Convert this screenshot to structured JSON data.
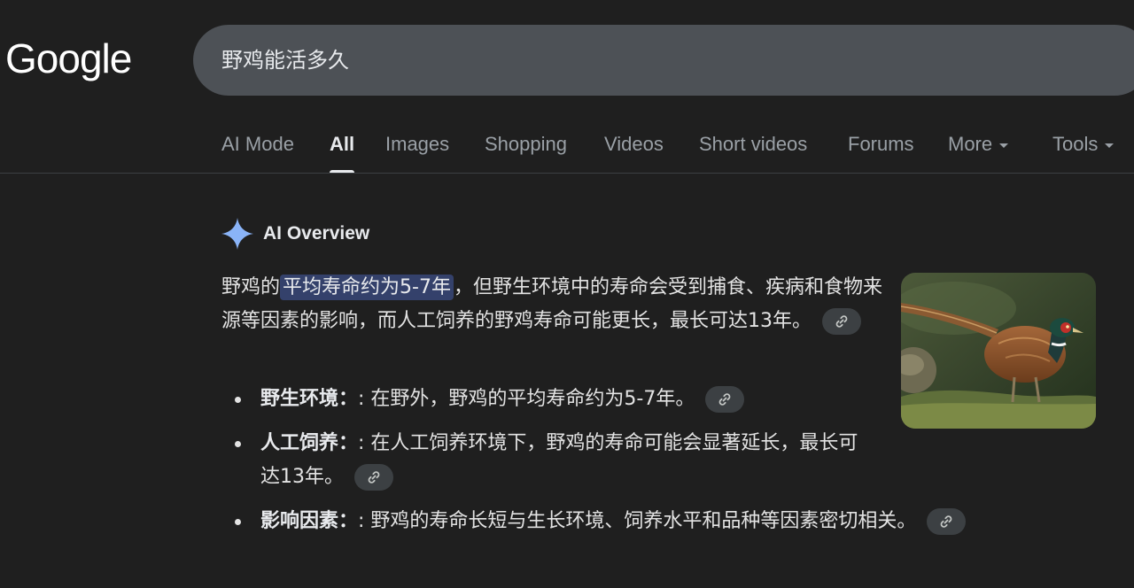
{
  "header": {
    "logo_text": "Google",
    "search": {
      "value": "野鸡能活多久"
    }
  },
  "tabs": [
    {
      "label": "AI Mode",
      "active": false
    },
    {
      "label": "All",
      "active": true
    },
    {
      "label": "Images",
      "active": false
    },
    {
      "label": "Shopping",
      "active": false
    },
    {
      "label": "Videos",
      "active": false
    },
    {
      "label": "Short videos",
      "active": false
    },
    {
      "label": "Forums",
      "active": false
    },
    {
      "label": "More",
      "active": false,
      "dropdown": true
    },
    {
      "label": "Tools",
      "active": false,
      "dropdown": true
    }
  ],
  "ai_overview": {
    "icon": "sparkle-icon",
    "title": "AI Overview",
    "summary": {
      "before": "野鸡的",
      "highlight": "平均寿命约为5-7年",
      "after": "，但野生环境中的寿命会受到捕食、疾病和食物来源等因素的影响，而人工饲养的野鸡寿命可能更长，最长可达13年。"
    },
    "bullets": [
      {
        "term": "野生环境：",
        "text": ": 在野外，野鸡的平均寿命约为5-7年。"
      },
      {
        "term": "人工饲养：",
        "text": ": 在人工饲养环境下，野鸡的寿命可能会显著延长，最长可达13年。"
      },
      {
        "term": "影响因素：",
        "text": ": 野鸡的寿命长短与生长环境、饲养水平和品种等因素密切相关。"
      }
    ],
    "image_subject": "pheasant"
  },
  "colors": {
    "background": "#1f1f1f",
    "search_bg": "#4d5156",
    "highlight_bg": "#34416b",
    "sparkle": "#8ab4f8"
  }
}
